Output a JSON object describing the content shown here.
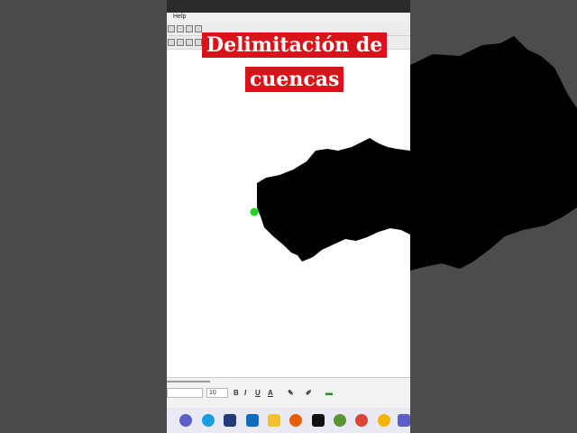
{
  "app": {
    "menu_help": "Help"
  },
  "overlay": {
    "title_line_1": "Delimitación de",
    "title_line_2": "cuencas"
  },
  "format_bar": {
    "font_size": "10",
    "bold": "B",
    "italic": "I",
    "underline": "U"
  },
  "colors": {
    "title_background": "#d8141a",
    "title_text": "#ffffff",
    "watershed_fill": "#000000",
    "pour_point": "#1fd31f",
    "side_background": "#4a4a4a"
  },
  "taskbar": {
    "icons": [
      "chat-icon",
      "edge-icon",
      "dropbox-icon",
      "mail-icon",
      "file-explorer-icon",
      "firefox-icon",
      "notion-icon",
      "qgis-icon",
      "chrome-icon",
      "chrome-beta-icon",
      "teams-icon"
    ]
  }
}
